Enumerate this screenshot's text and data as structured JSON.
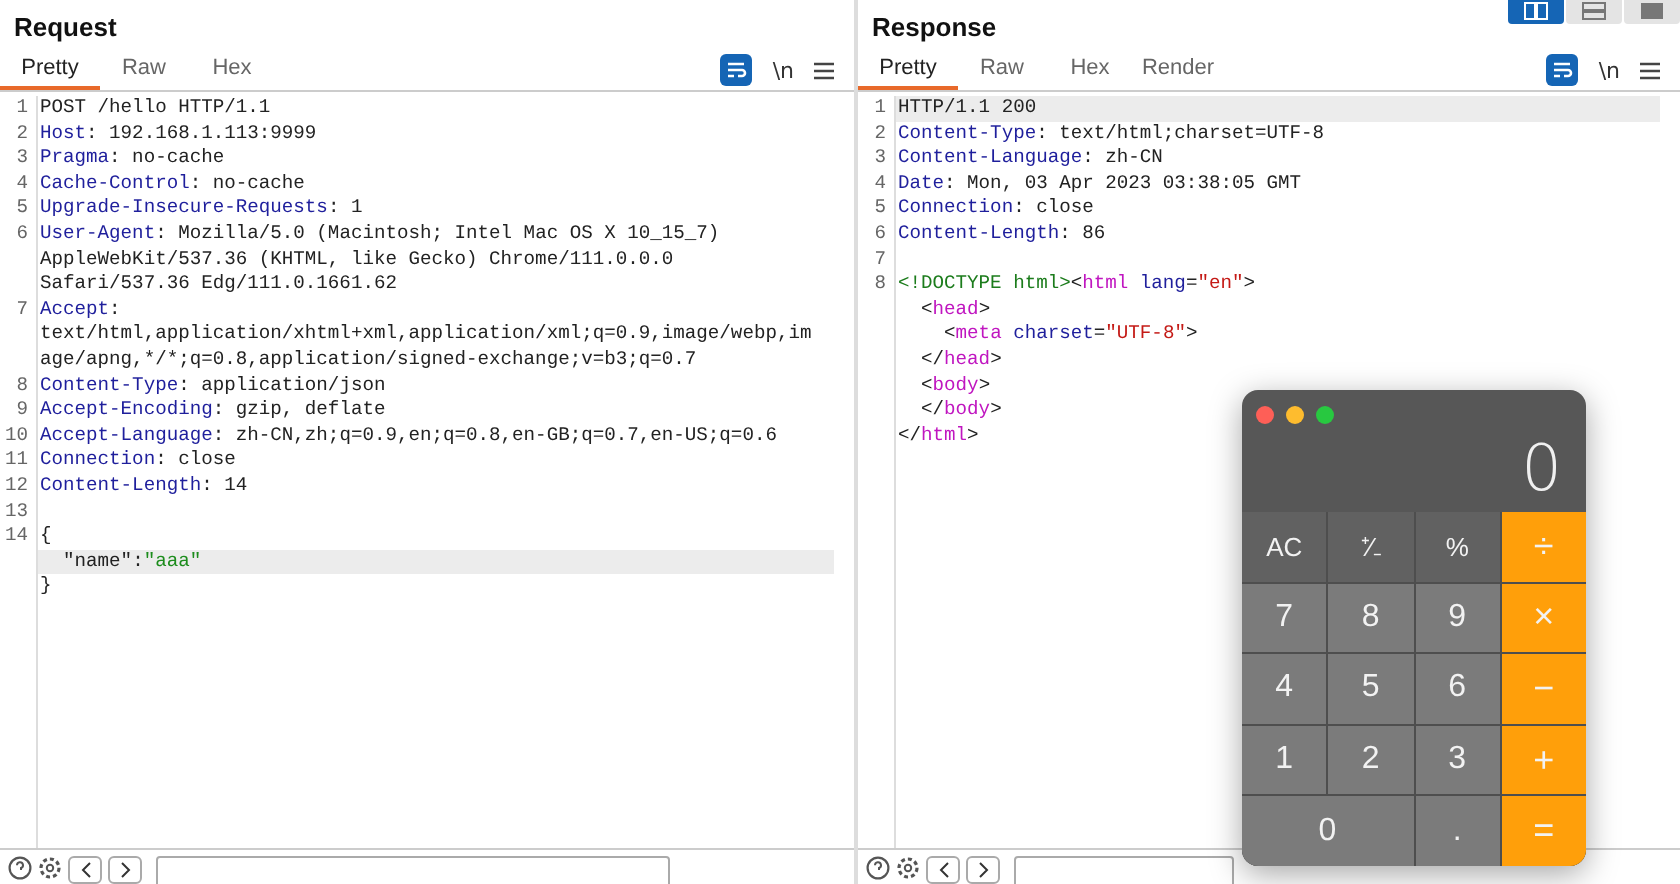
{
  "layout_buttons": [
    {
      "selected": true
    },
    {
      "selected": false
    },
    {
      "selected": false
    }
  ],
  "panels": [
    {
      "title": "Request",
      "tabs": [
        {
          "label": "Pretty",
          "selected": true
        },
        {
          "label": "Raw",
          "selected": false
        },
        {
          "label": "Hex",
          "selected": false
        }
      ],
      "newline_toggle": "\\n",
      "rows": [
        {
          "number": "1",
          "highlighted": false,
          "parts": [
            {
              "kind": "text",
              "text": "POST /hello HTTP/1.1"
            }
          ]
        },
        {
          "number": "2",
          "highlighted": false,
          "parts": [
            {
              "kind": "key",
              "text": "Host"
            },
            {
              "kind": "text",
              "text": ": 192.168.1.113:9999"
            }
          ]
        },
        {
          "number": "3",
          "highlighted": false,
          "parts": [
            {
              "kind": "key",
              "text": "Pragma"
            },
            {
              "kind": "text",
              "text": ": no-cache"
            }
          ]
        },
        {
          "number": "4",
          "highlighted": false,
          "parts": [
            {
              "kind": "key",
              "text": "Cache-Control"
            },
            {
              "kind": "text",
              "text": ": no-cache"
            }
          ]
        },
        {
          "number": "5",
          "highlighted": false,
          "parts": [
            {
              "kind": "key",
              "text": "Upgrade-Insecure-Requests"
            },
            {
              "kind": "text",
              "text": ": 1"
            }
          ]
        },
        {
          "number": "6",
          "highlighted": false,
          "parts": [
            {
              "kind": "key",
              "text": "User-Agent"
            },
            {
              "kind": "text",
              "text": ": Mozilla/5.0 (Macintosh; Intel Mac OS X 10_15_7)"
            }
          ]
        },
        {
          "highlighted": false,
          "parts": [
            {
              "kind": "text",
              "text": "AppleWebKit/537.36 (KHTML, like Gecko) Chrome/111.0.0.0"
            }
          ]
        },
        {
          "highlighted": false,
          "parts": [
            {
              "kind": "text",
              "text": "Safari/537.36 Edg/111.0.1661.62"
            }
          ]
        },
        {
          "number": "7",
          "highlighted": false,
          "parts": [
            {
              "kind": "key",
              "text": "Accept"
            },
            {
              "kind": "text",
              "text": ":"
            }
          ]
        },
        {
          "highlighted": false,
          "parts": [
            {
              "kind": "text",
              "text": "text/html,application/xhtml+xml,application/xml;q=0.9,image/webp,im"
            }
          ]
        },
        {
          "highlighted": false,
          "parts": [
            {
              "kind": "text",
              "text": "age/apng,*/*;q=0.8,application/signed-exchange;v=b3;q=0.7"
            }
          ]
        },
        {
          "number": "8",
          "highlighted": false,
          "parts": [
            {
              "kind": "key",
              "text": "Content-Type"
            },
            {
              "kind": "text",
              "text": ": application/json"
            }
          ]
        },
        {
          "number": "9",
          "highlighted": false,
          "parts": [
            {
              "kind": "key",
              "text": "Accept-Encoding"
            },
            {
              "kind": "text",
              "text": ": gzip, deflate"
            }
          ]
        },
        {
          "number": "10",
          "highlighted": false,
          "parts": [
            {
              "kind": "key",
              "text": "Accept-Language"
            },
            {
              "kind": "text",
              "text": ": zh-CN,zh;q=0.9,en;q=0.8,en-GB;q=0.7,en-US;q=0.6"
            }
          ]
        },
        {
          "number": "11",
          "highlighted": false,
          "parts": [
            {
              "kind": "key",
              "text": "Connection"
            },
            {
              "kind": "text",
              "text": ": close"
            }
          ]
        },
        {
          "number": "12",
          "highlighted": false,
          "parts": [
            {
              "kind": "key",
              "text": "Content-Length"
            },
            {
              "kind": "text",
              "text": ": 14"
            }
          ]
        },
        {
          "number": "13",
          "highlighted": false,
          "parts": []
        },
        {
          "number": "14",
          "highlighted": false,
          "parts": [
            {
              "kind": "text",
              "text": "{"
            }
          ]
        },
        {
          "highlighted": true,
          "parts": [
            {
              "kind": "jsonkey",
              "text": "  \"name\""
            },
            {
              "kind": "text",
              "text": ":"
            },
            {
              "kind": "jsonstring",
              "text": "\"aaa\""
            }
          ]
        },
        {
          "highlighted": false,
          "parts": [
            {
              "kind": "text",
              "text": "}"
            }
          ]
        }
      ]
    },
    {
      "title": "Response",
      "tabs": [
        {
          "label": "Pretty",
          "selected": true
        },
        {
          "label": "Raw",
          "selected": false
        },
        {
          "label": "Hex",
          "selected": false
        },
        {
          "label": "Render",
          "selected": false
        }
      ],
      "newline_toggle": "\\n",
      "rows": [
        {
          "number": "1",
          "highlighted": true,
          "parts": [
            {
              "kind": "text",
              "text": "HTTP/1.1 200"
            }
          ]
        },
        {
          "number": "2",
          "highlighted": false,
          "parts": [
            {
              "kind": "key",
              "text": "Content-Type"
            },
            {
              "kind": "text",
              "text": ": text/html;charset=UTF-8"
            }
          ]
        },
        {
          "number": "3",
          "highlighted": false,
          "parts": [
            {
              "kind": "key",
              "text": "Content-Language"
            },
            {
              "kind": "text",
              "text": ": zh-CN"
            }
          ]
        },
        {
          "number": "4",
          "highlighted": false,
          "parts": [
            {
              "kind": "key",
              "text": "Date"
            },
            {
              "kind": "text",
              "text": ": Mon, 03 Apr 2023 03:38:05 GMT"
            }
          ]
        },
        {
          "number": "5",
          "highlighted": false,
          "parts": [
            {
              "kind": "key",
              "text": "Connection"
            },
            {
              "kind": "text",
              "text": ": close"
            }
          ]
        },
        {
          "number": "6",
          "highlighted": false,
          "parts": [
            {
              "kind": "key",
              "text": "Content-Length"
            },
            {
              "kind": "text",
              "text": ": 86"
            }
          ]
        },
        {
          "number": "7",
          "highlighted": false,
          "parts": []
        },
        {
          "number": "8",
          "highlighted": false,
          "parts": [
            {
              "kind": "doctype",
              "text": "<!DOCTYPE html>"
            },
            {
              "kind": "text",
              "text": "<"
            },
            {
              "kind": "tag",
              "text": "html"
            },
            {
              "kind": "attr",
              "text": " lang"
            },
            {
              "kind": "text",
              "text": "="
            },
            {
              "kind": "string",
              "text": "\"en\""
            },
            {
              "kind": "text",
              "text": ">"
            }
          ]
        },
        {
          "highlighted": false,
          "parts": [
            {
              "kind": "text",
              "text": "  <"
            },
            {
              "kind": "tag",
              "text": "head"
            },
            {
              "kind": "text",
              "text": ">"
            }
          ]
        },
        {
          "highlighted": false,
          "parts": [
            {
              "kind": "text",
              "text": "    <"
            },
            {
              "kind": "tag",
              "text": "meta"
            },
            {
              "kind": "attr",
              "text": " charset"
            },
            {
              "kind": "text",
              "text": "="
            },
            {
              "kind": "string",
              "text": "\"UTF-8\""
            },
            {
              "kind": "text",
              "text": ">"
            }
          ]
        },
        {
          "highlighted": false,
          "parts": [
            {
              "kind": "text",
              "text": "  </"
            },
            {
              "kind": "tag",
              "text": "head"
            },
            {
              "kind": "text",
              "text": ">"
            }
          ]
        },
        {
          "highlighted": false,
          "parts": [
            {
              "kind": "text",
              "text": "  <"
            },
            {
              "kind": "tag",
              "text": "body"
            },
            {
              "kind": "text",
              "text": ">"
            }
          ]
        },
        {
          "highlighted": false,
          "parts": [
            {
              "kind": "text",
              "text": "  </"
            },
            {
              "kind": "tag",
              "text": "body"
            },
            {
              "kind": "text",
              "text": ">"
            }
          ]
        },
        {
          "highlighted": false,
          "parts": [
            {
              "kind": "text",
              "text": "</"
            },
            {
              "kind": "tag",
              "text": "html"
            },
            {
              "kind": "text",
              "text": ">"
            }
          ]
        }
      ]
    }
  ],
  "calculator": {
    "display": "0",
    "keys": [
      {
        "label": "AC",
        "kind": "function",
        "wide": false
      },
      {
        "label": "⁺∕₋",
        "kind": "function",
        "wide": false
      },
      {
        "label": "%",
        "kind": "function",
        "wide": false
      },
      {
        "label": "÷",
        "kind": "operator",
        "wide": false
      },
      {
        "label": "7",
        "kind": "digit",
        "wide": false
      },
      {
        "label": "8",
        "kind": "digit",
        "wide": false
      },
      {
        "label": "9",
        "kind": "digit",
        "wide": false
      },
      {
        "label": "×",
        "kind": "operator",
        "wide": false
      },
      {
        "label": "4",
        "kind": "digit",
        "wide": false
      },
      {
        "label": "5",
        "kind": "digit",
        "wide": false
      },
      {
        "label": "6",
        "kind": "digit",
        "wide": false
      },
      {
        "label": "−",
        "kind": "operator",
        "wide": false
      },
      {
        "label": "1",
        "kind": "digit",
        "wide": false
      },
      {
        "label": "2",
        "kind": "digit",
        "wide": false
      },
      {
        "label": "3",
        "kind": "digit",
        "wide": false
      },
      {
        "label": "+",
        "kind": "operator",
        "wide": false
      },
      {
        "label": "0",
        "kind": "digit",
        "wide": true
      },
      {
        "label": ".",
        "kind": "digit",
        "wide": false
      },
      {
        "label": "=",
        "kind": "operator",
        "wide": false
      }
    ]
  }
}
